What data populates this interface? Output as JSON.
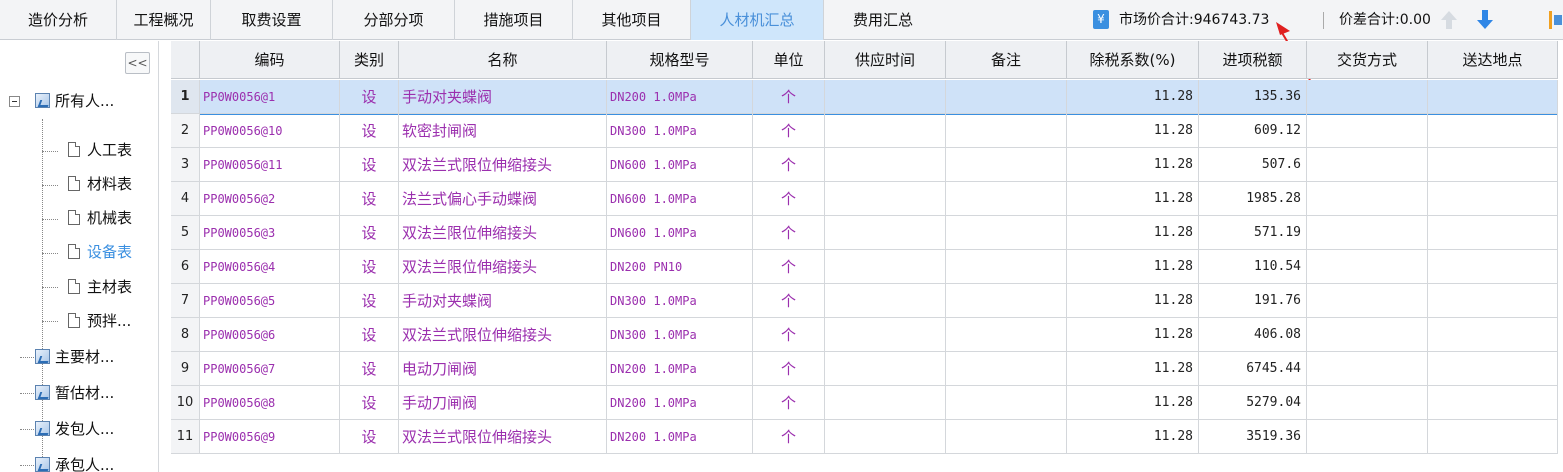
{
  "tabs": [
    {
      "label": "造价分析",
      "active": false
    },
    {
      "label": "工程概况",
      "active": false
    },
    {
      "label": "取费设置",
      "active": false
    },
    {
      "label": "分部分项",
      "active": false
    },
    {
      "label": "措施项目",
      "active": false
    },
    {
      "label": "其他项目",
      "active": false
    },
    {
      "label": "人材机汇总",
      "active": true
    },
    {
      "label": "费用汇总",
      "active": false
    }
  ],
  "summary": {
    "yen_symbol": "¥",
    "market_total": "市场价合计:946743.73",
    "diff_total": "价差合计:0.00"
  },
  "tree": {
    "collapse_label": "<<",
    "items": [
      {
        "label": "所有人...",
        "icon": "folder-icon"
      },
      {
        "label": "人工表",
        "icon": "doc-icon"
      },
      {
        "label": "材料表",
        "icon": "doc-icon"
      },
      {
        "label": "机械表",
        "icon": "doc-icon"
      },
      {
        "label": "设备表",
        "icon": "doc-icon",
        "selected": true
      },
      {
        "label": "主材表",
        "icon": "doc-icon"
      },
      {
        "label": "预拌...",
        "icon": "doc-icon"
      },
      {
        "label": "主要材...",
        "icon": "folder-icon"
      },
      {
        "label": "暂估材...",
        "icon": "folder-icon"
      },
      {
        "label": "发包人...",
        "icon": "folder-icon"
      },
      {
        "label": "承包人...",
        "icon": "folder-icon"
      }
    ]
  },
  "table": {
    "headers": [
      "编码",
      "类别",
      "名称",
      "规格型号",
      "单位",
      "供应时间",
      "备注",
      "除税系数(%)",
      "进项税额",
      "交货方式",
      "送达地点"
    ],
    "rows": [
      {
        "num": "1",
        "code": "PP0W0056@1",
        "type": "设",
        "name": "手动对夹蝶阀",
        "spec": "DN200 1.0MPa",
        "unit": "个",
        "supply": "",
        "remark": "",
        "coef": "11.28",
        "tax": "135.36",
        "delivery": "",
        "place": ""
      },
      {
        "num": "2",
        "code": "PP0W0056@10",
        "type": "设",
        "name": "软密封闸阀",
        "spec": "DN300 1.0MPa",
        "unit": "个",
        "supply": "",
        "remark": "",
        "coef": "11.28",
        "tax": "609.12",
        "delivery": "",
        "place": ""
      },
      {
        "num": "3",
        "code": "PP0W0056@11",
        "type": "设",
        "name": "双法兰式限位伸缩接头",
        "spec": "DN600 1.0MPa",
        "unit": "个",
        "supply": "",
        "remark": "",
        "coef": "11.28",
        "tax": "507.6",
        "delivery": "",
        "place": ""
      },
      {
        "num": "4",
        "code": "PP0W0056@2",
        "type": "设",
        "name": "法兰式偏心手动蝶阀",
        "spec": "DN600 1.0MPa",
        "unit": "个",
        "supply": "",
        "remark": "",
        "coef": "11.28",
        "tax": "1985.28",
        "delivery": "",
        "place": ""
      },
      {
        "num": "5",
        "code": "PP0W0056@3",
        "type": "设",
        "name": "双法兰限位伸缩接头",
        "spec": "DN600 1.0MPa",
        "unit": "个",
        "supply": "",
        "remark": "",
        "coef": "11.28",
        "tax": "571.19",
        "delivery": "",
        "place": ""
      },
      {
        "num": "6",
        "code": "PP0W0056@4",
        "type": "设",
        "name": "双法兰限位伸缩接头",
        "spec": "DN200 PN10",
        "unit": "个",
        "supply": "",
        "remark": "",
        "coef": "11.28",
        "tax": "110.54",
        "delivery": "",
        "place": ""
      },
      {
        "num": "7",
        "code": "PP0W0056@5",
        "type": "设",
        "name": "手动对夹蝶阀",
        "spec": "DN300 1.0MPa",
        "unit": "个",
        "supply": "",
        "remark": "",
        "coef": "11.28",
        "tax": "191.76",
        "delivery": "",
        "place": ""
      },
      {
        "num": "8",
        "code": "PP0W0056@6",
        "type": "设",
        "name": "双法兰式限位伸缩接头",
        "spec": "DN300 1.0MPa",
        "unit": "个",
        "supply": "",
        "remark": "",
        "coef": "11.28",
        "tax": "406.08",
        "delivery": "",
        "place": ""
      },
      {
        "num": "9",
        "code": "PP0W0056@7",
        "type": "设",
        "name": "电动刀闸阀",
        "spec": "DN200 1.0MPa",
        "unit": "个",
        "supply": "",
        "remark": "",
        "coef": "11.28",
        "tax": "6745.44",
        "delivery": "",
        "place": ""
      },
      {
        "num": "10",
        "code": "PP0W0056@8",
        "type": "设",
        "name": "手动刀闸阀",
        "spec": "DN200 1.0MPa",
        "unit": "个",
        "supply": "",
        "remark": "",
        "coef": "11.28",
        "tax": "5279.04",
        "delivery": "",
        "place": ""
      },
      {
        "num": "11",
        "code": "PP0W0056@9",
        "type": "设",
        "name": "双法兰式限位伸缩接头",
        "spec": "DN200 1.0MPa",
        "unit": "个",
        "supply": "",
        "remark": "",
        "coef": "11.28",
        "tax": "3519.36",
        "delivery": "",
        "place": ""
      }
    ],
    "selected_row": 1
  },
  "colors": {
    "accent": "#3a8fe0",
    "active_tab_bg": "#cfe6fb",
    "selected_row_bg": "#cfe2f8",
    "material_text": "#9b2fae",
    "annotation_arrow": "#e02020"
  }
}
